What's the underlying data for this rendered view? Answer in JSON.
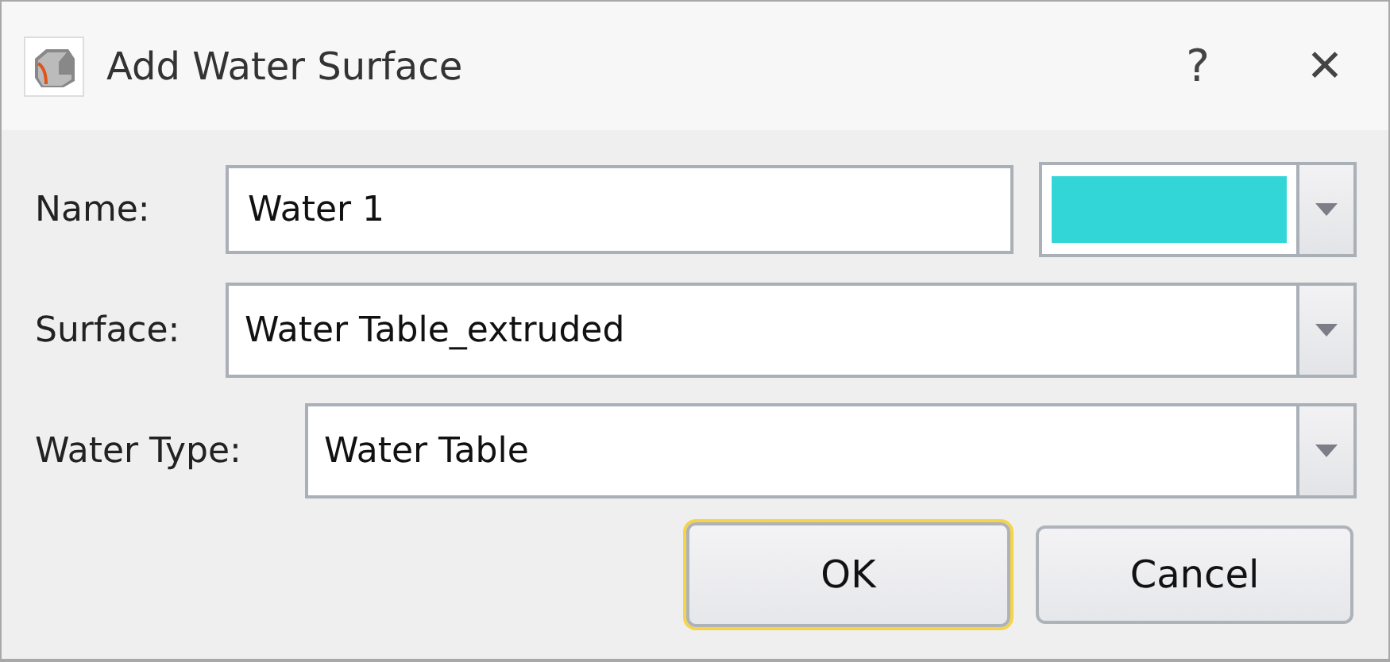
{
  "window": {
    "title": "Add Water Surface",
    "help": "?",
    "close": "✕"
  },
  "fields": [
    {
      "label": "Name:",
      "value": "Water 1",
      "kind": "text"
    },
    {
      "label": "Surface:",
      "value": "Water Table_extruded",
      "kind": "dropdown"
    },
    {
      "label": "Water Type:",
      "value": "Water Table",
      "kind": "dropdown"
    }
  ],
  "color_picker": {
    "color": "#33d6d6"
  },
  "buttons": [
    {
      "label": "OK",
      "focused": true
    },
    {
      "label": "Cancel",
      "focused": false
    }
  ]
}
